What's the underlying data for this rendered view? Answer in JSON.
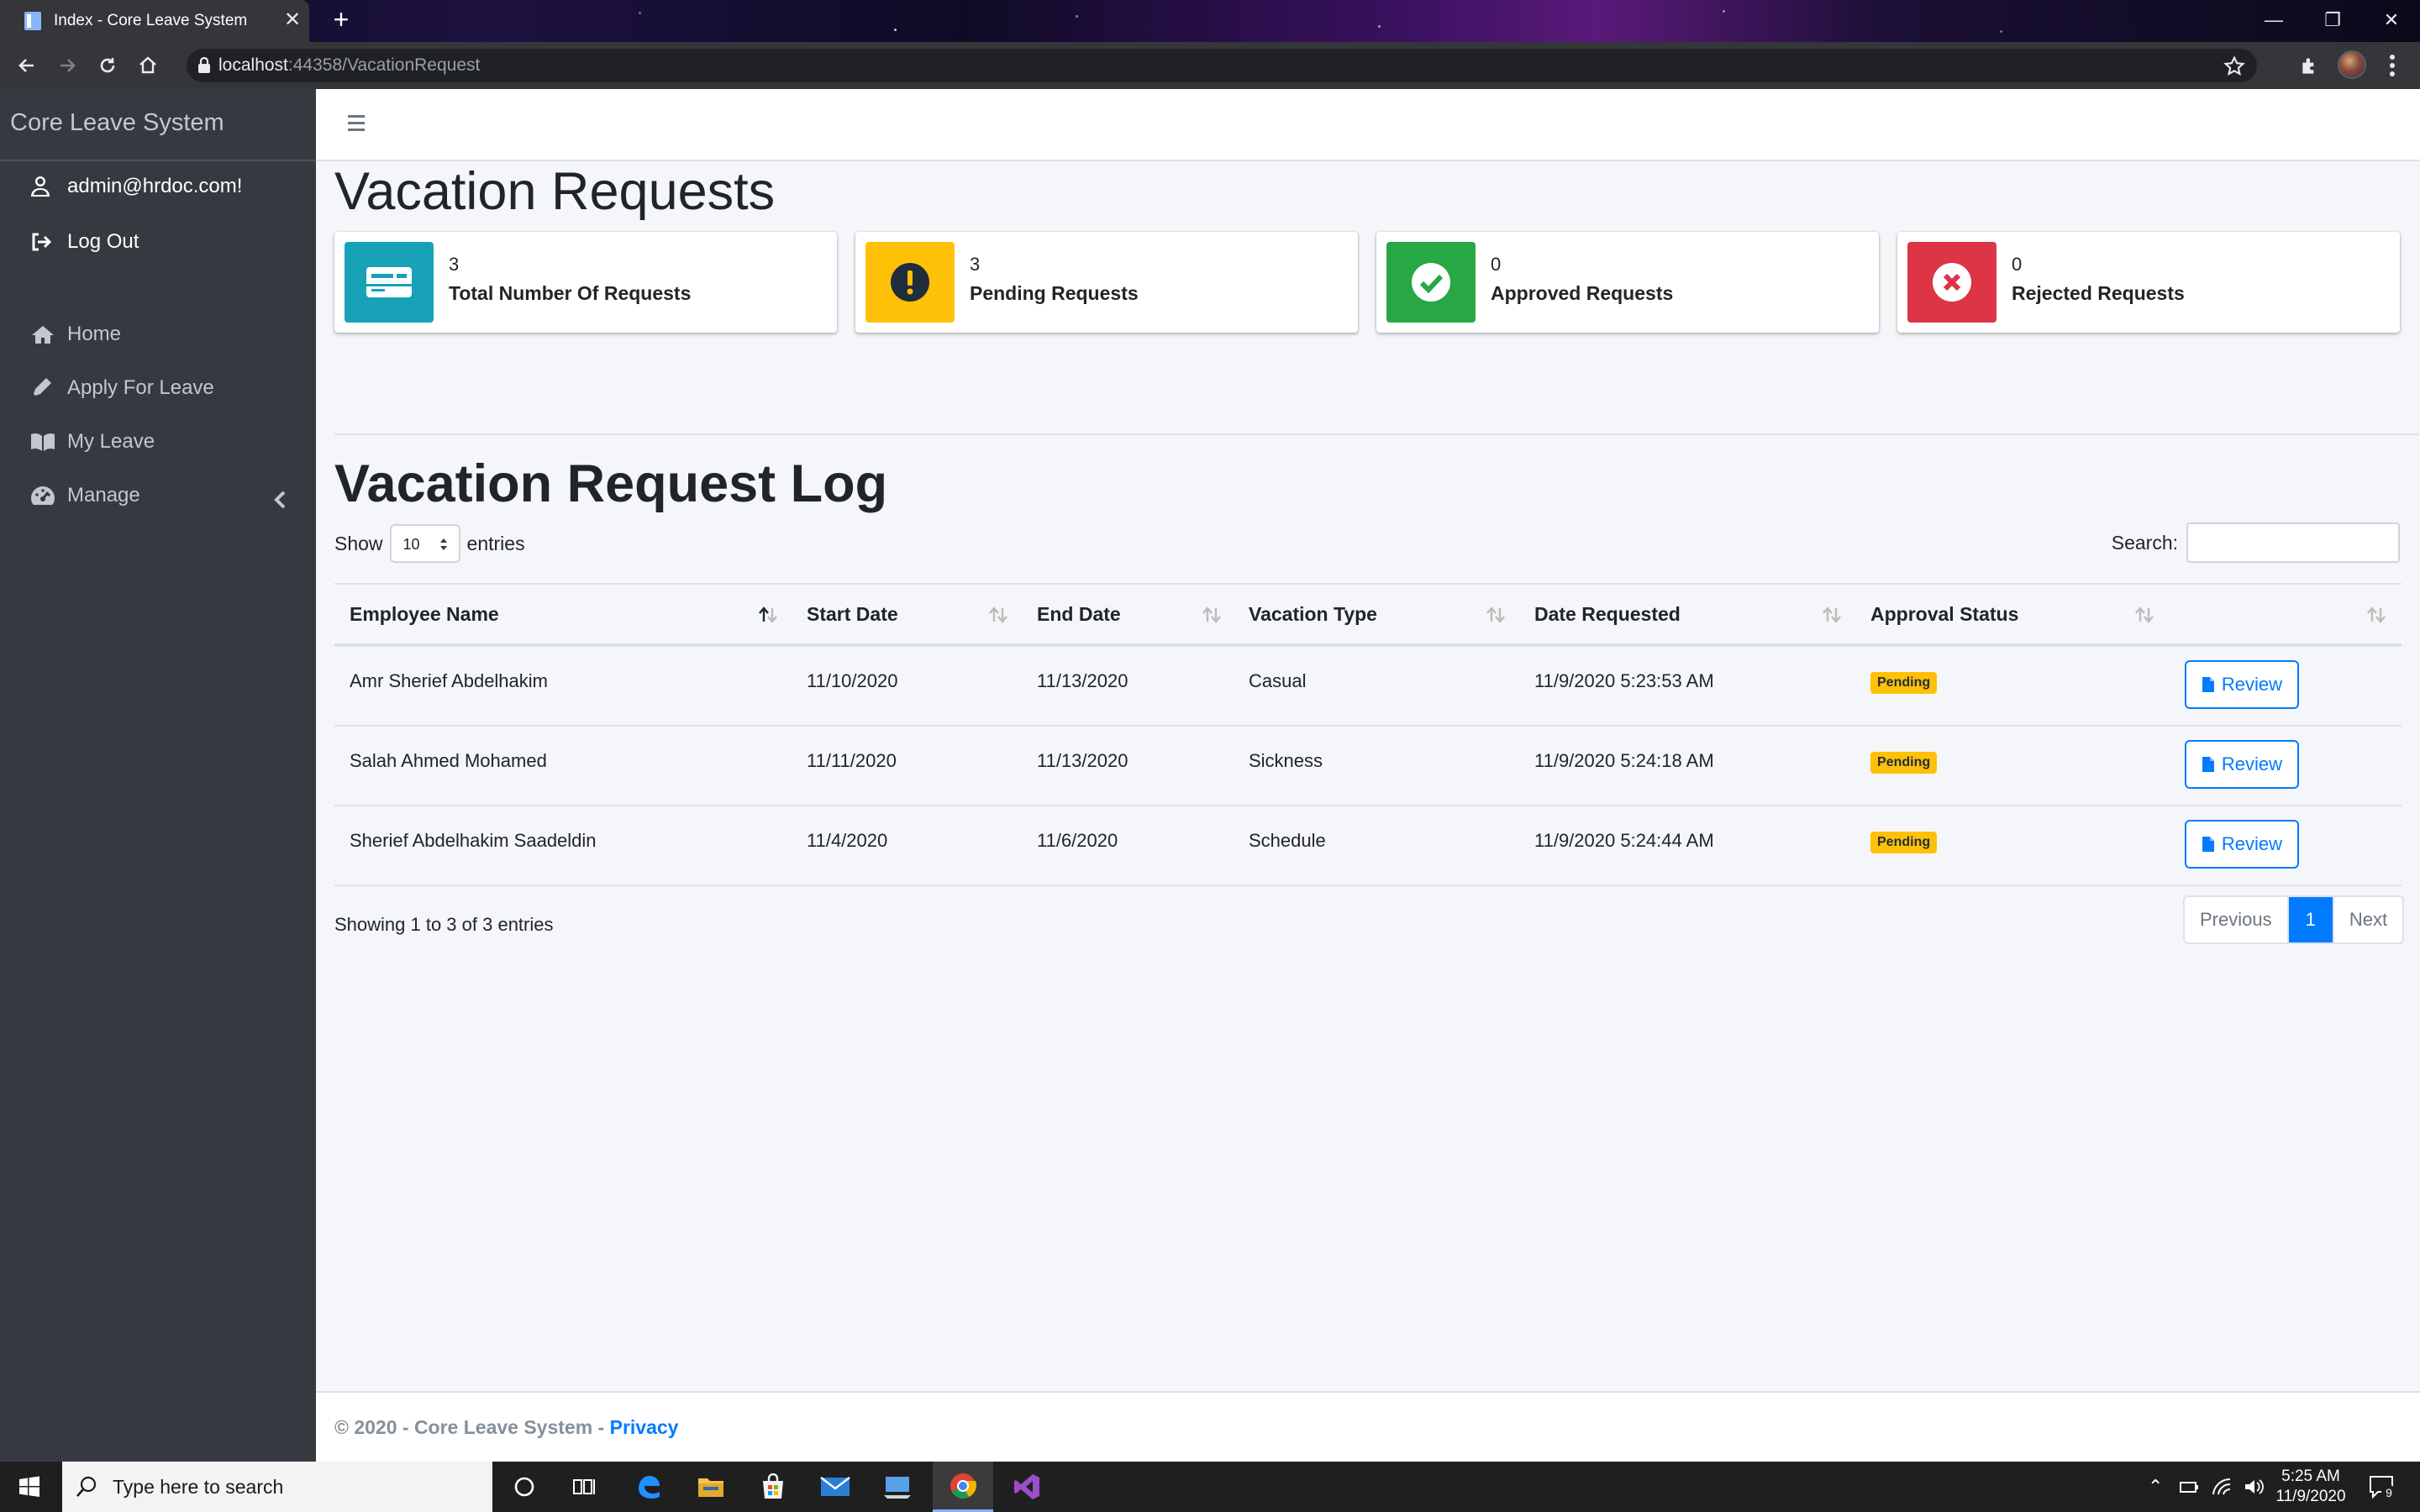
{
  "browser": {
    "tab_title": "Index - Core Leave System",
    "url_host": "localhost",
    "url_rest": ":44358/VacationRequest"
  },
  "sidebar": {
    "brand": "Core Leave System",
    "user": "admin@hrdoc.com!",
    "logout": "Log Out",
    "items": [
      {
        "label": "Home",
        "icon": "home-icon"
      },
      {
        "label": "Apply For Leave",
        "icon": "pencil-icon"
      },
      {
        "label": "My Leave",
        "icon": "book-icon"
      },
      {
        "label": "Manage",
        "icon": "dashboard-icon"
      }
    ]
  },
  "page": {
    "title": "Vacation Requests",
    "stats": [
      {
        "value": "3",
        "label": "Total Number Of Requests",
        "color": "#17a2b8",
        "icon": "card-icon"
      },
      {
        "value": "3",
        "label": "Pending Requests",
        "color": "#ffc107",
        "icon": "exclamation-icon"
      },
      {
        "value": "0",
        "label": "Approved Requests",
        "color": "#28a745",
        "icon": "check-icon"
      },
      {
        "value": "0",
        "label": "Rejected Requests",
        "color": "#dc3545",
        "icon": "x-icon"
      }
    ],
    "log_title": "Vacation Request Log",
    "show_label": "Show",
    "entries_value": "10",
    "entries_label": "entries",
    "search_label": "Search:",
    "search_value": "",
    "columns": [
      "Employee Name",
      "Start Date",
      "End Date",
      "Vacation Type",
      "Date Requested",
      "Approval Status"
    ],
    "rows": [
      {
        "name": "Amr Sherief Abdelhakim",
        "start": "11/10/2020",
        "end": "11/13/2020",
        "type": "Casual",
        "requested": "11/9/2020 5:23:53 AM",
        "status": "Pending",
        "action": "Review"
      },
      {
        "name": "Salah Ahmed Mohamed",
        "start": "11/11/2020",
        "end": "11/13/2020",
        "type": "Sickness",
        "requested": "11/9/2020 5:24:18 AM",
        "status": "Pending",
        "action": "Review"
      },
      {
        "name": "Sherief Abdelhakim Saadeldin",
        "start": "11/4/2020",
        "end": "11/6/2020",
        "type": "Schedule",
        "requested": "11/9/2020 5:24:44 AM",
        "status": "Pending",
        "action": "Review"
      }
    ],
    "showing": "Showing 1 to 3 of 3 entries",
    "pagination": {
      "prev": "Previous",
      "current": "1",
      "next": "Next"
    }
  },
  "footer": {
    "text": "© 2020 - Core Leave System - ",
    "link": "Privacy"
  },
  "taskbar": {
    "search_placeholder": "Type here to search",
    "time": "5:25 AM",
    "date": "11/9/2020",
    "notifications": "9"
  }
}
